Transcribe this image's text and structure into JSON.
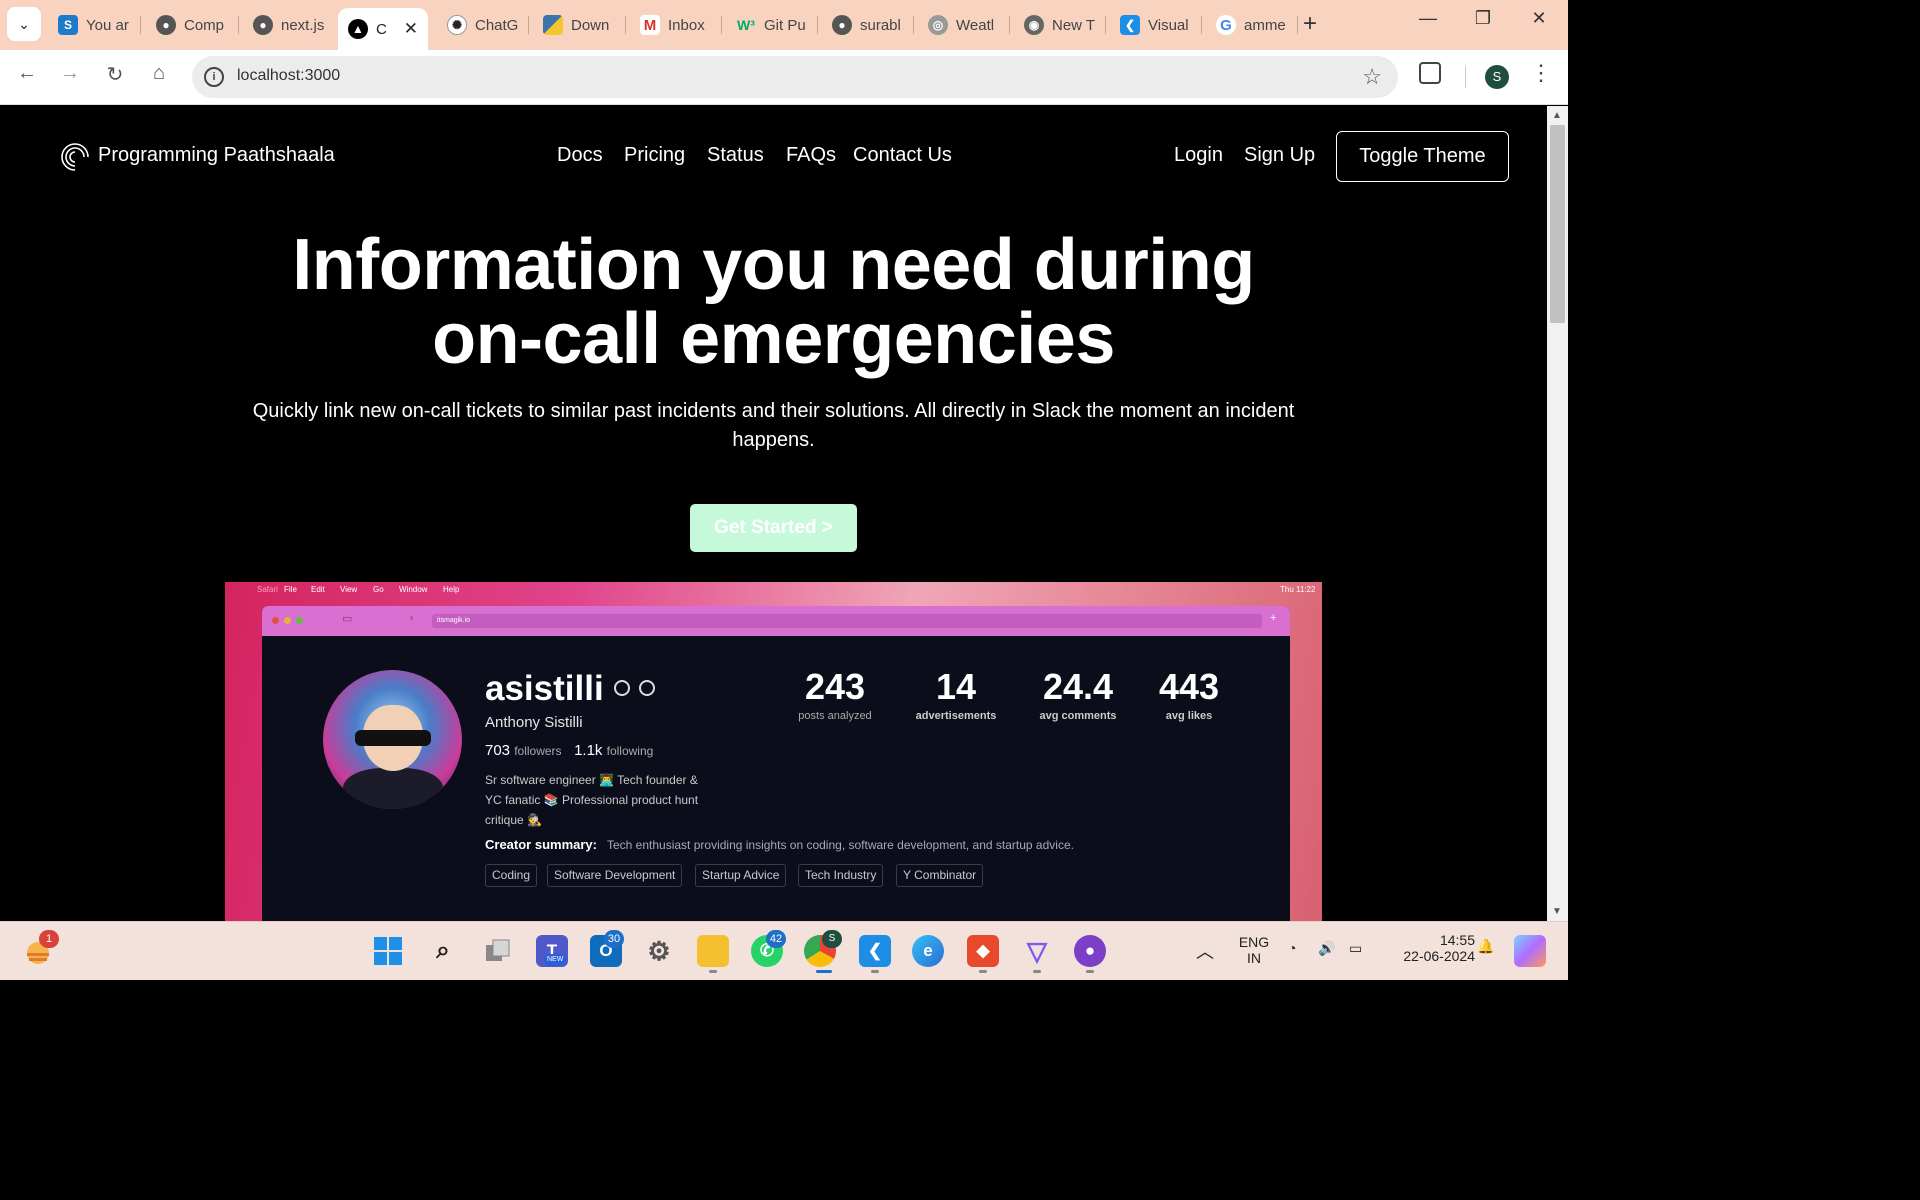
{
  "browser": {
    "tabs": [
      {
        "label": "You ar",
        "icon": "s-icon",
        "color": "#1f7ac9"
      },
      {
        "label": "Comp",
        "icon": "github-icon",
        "color": "#222222"
      },
      {
        "label": "next.js",
        "icon": "github-icon",
        "color": "#222222"
      },
      {
        "label": "C",
        "icon": "vercel-icon",
        "color": "#000000",
        "active": true
      },
      {
        "label": "ChatG",
        "icon": "openai-icon",
        "color": "#222222"
      },
      {
        "label": "Down",
        "icon": "python-icon",
        "color": "#3a74a8"
      },
      {
        "label": "Inbox",
        "icon": "gmail-icon",
        "color": "#d93025"
      },
      {
        "label": "Git Pu",
        "icon": "w3-icon",
        "color": "#04aa6d"
      },
      {
        "label": "surabl",
        "icon": "github-icon",
        "color": "#222222"
      },
      {
        "label": "Weatl",
        "icon": "globe-icon",
        "color": "#666666"
      },
      {
        "label": "New T",
        "icon": "chrome-icon",
        "color": "#555555"
      },
      {
        "label": "Visual",
        "icon": "vscode-icon",
        "color": "#1d8ee6"
      },
      {
        "label": "amme",
        "icon": "google-icon",
        "color": "#4285f4"
      }
    ],
    "url": "localhost:3000",
    "profile_initial": "S"
  },
  "site": {
    "brand": "Programming Paathshaala",
    "nav": [
      "Docs",
      "Pricing",
      "Status",
      "FAQs",
      "Contact Us"
    ],
    "login": "Login",
    "signup": "Sign Up",
    "toggle_theme": "Toggle Theme"
  },
  "hero": {
    "title_line1": "Information you need during",
    "title_line2": "on-call emergencies",
    "subtitle": "Quickly link new on-call tickets to similar past incidents and their solutions. All directly in Slack the moment an incident happens.",
    "cta": "Get Started >",
    "cta_color": "#c6f8da"
  },
  "preview": {
    "mac_menu": [
      "Safari",
      "File",
      "Edit",
      "View",
      "Go",
      "Window",
      "Help"
    ],
    "mac_time": "Thu 11:22",
    "inner_url": "itsmagik.io",
    "username": "asistilli",
    "full_name": "Anthony Sistilli",
    "followers": "703",
    "followers_label": "followers",
    "following": "1.1k",
    "following_label": "following",
    "bio": "Sr software engineer 👨‍💻 Tech founder & YC fanatic 📚 Professional product hunt critique 🕵️",
    "stats": [
      {
        "value": "243",
        "label": "posts analyzed"
      },
      {
        "value": "14",
        "label": "advertisements"
      },
      {
        "value": "24.4",
        "label": "avg comments"
      },
      {
        "value": "443",
        "label": "avg likes"
      }
    ],
    "summary_label": "Creator summary:",
    "summary_text": "Tech enthusiast providing insights on coding, software development, and startup advice.",
    "tags": [
      "Coding",
      "Software Development",
      "Startup Advice",
      "Tech Industry",
      "Y Combinator"
    ]
  },
  "taskbar": {
    "weather_badge": "1",
    "teams_badge": "NEW",
    "outlook_badge": "30",
    "whatsapp_badge": "42",
    "chrome_badge": "S",
    "language": "ENG",
    "region": "IN",
    "time": "14:55",
    "date": "22-06-2024"
  }
}
